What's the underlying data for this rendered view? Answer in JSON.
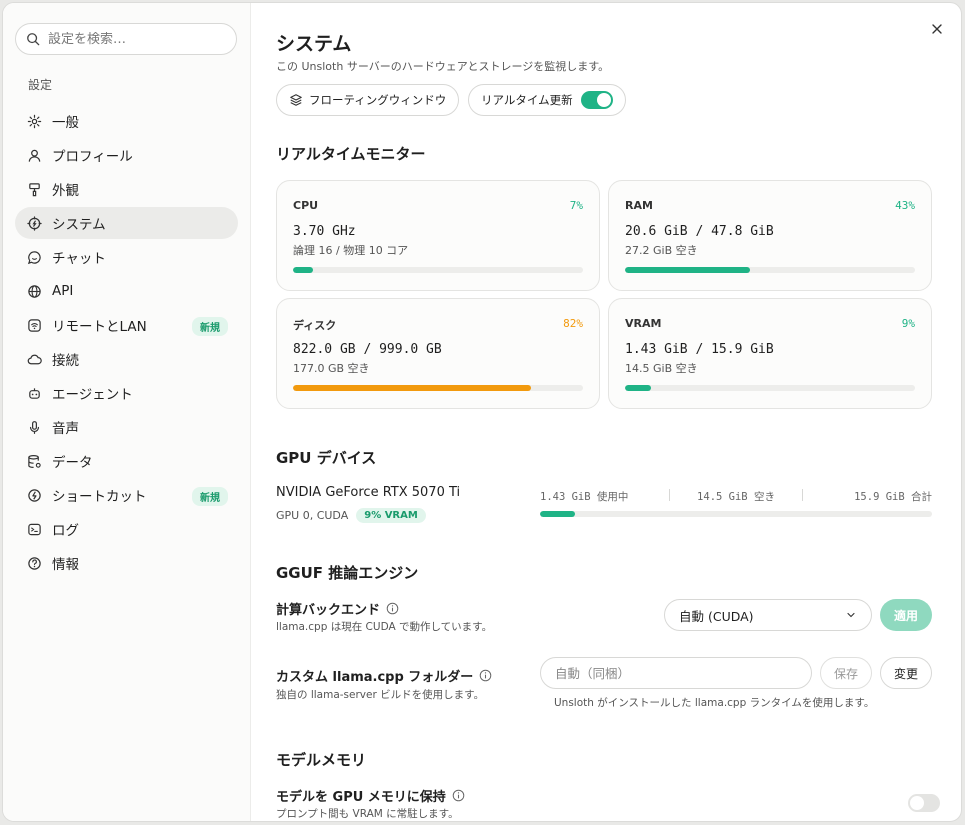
{
  "sidebar": {
    "search_placeholder": "設定を検索…",
    "heading": "設定",
    "items": [
      {
        "label": "一般",
        "icon": "gear-icon"
      },
      {
        "label": "プロフィール",
        "icon": "user-icon"
      },
      {
        "label": "外観",
        "icon": "paintbrush-icon"
      },
      {
        "label": "システム",
        "icon": "cpu-icon",
        "active": true
      },
      {
        "label": "チャット",
        "icon": "chat-icon"
      },
      {
        "label": "API",
        "icon": "globe-icon"
      },
      {
        "label": "リモートとLAN",
        "icon": "wifi-icon",
        "badge": "新規"
      },
      {
        "label": "接続",
        "icon": "cloud-icon"
      },
      {
        "label": "エージェント",
        "icon": "bot-icon"
      },
      {
        "label": "音声",
        "icon": "mic-icon"
      },
      {
        "label": "データ",
        "icon": "database-icon"
      },
      {
        "label": "ショートカット",
        "icon": "bolt-icon",
        "badge": "新規"
      },
      {
        "label": "ログ",
        "icon": "terminal-icon"
      },
      {
        "label": "情報",
        "icon": "help-icon"
      }
    ]
  },
  "header": {
    "title": "システム",
    "subtitle": "この Unsloth サーバーのハードウェアとストレージを監視します。",
    "floating_window_label": "フローティングウィンドウ",
    "realtime_label": "リアルタイム更新",
    "realtime_on": true
  },
  "monitor": {
    "title": "リアルタイムモニター",
    "cards": [
      {
        "label": "CPU",
        "pct": "7%",
        "fraction": 0.07,
        "value": "3.70 GHz",
        "sub": "論理 16 / 物理 10 コア",
        "color": "#1fb386"
      },
      {
        "label": "RAM",
        "pct": "43%",
        "fraction": 0.43,
        "value": "20.6 GiB / 47.8 GiB",
        "sub": "27.2 GiB 空き",
        "color": "#1fb386"
      },
      {
        "label": "ディスク",
        "pct": "82%",
        "fraction": 0.82,
        "value": "822.0 GB / 999.0 GB",
        "sub": "177.0 GB 空き",
        "color": "#f29a0e"
      },
      {
        "label": "VRAM",
        "pct": "9%",
        "fraction": 0.09,
        "value": "1.43 GiB / 15.9 GiB",
        "sub": "14.5 GiB 空き",
        "color": "#1fb386"
      }
    ]
  },
  "gpu": {
    "title": "GPU デバイス",
    "name": "NVIDIA GeForce RTX 5070 Ti",
    "sub": "GPU 0, CUDA",
    "badge": "9% VRAM",
    "used": "1.43 GiB 使用中",
    "free": "14.5 GiB 空き",
    "total": "15.9 GiB 合計",
    "fraction": 0.09
  },
  "engine": {
    "title": "GGUF 推論エンジン",
    "backend_label": "計算バックエンド",
    "backend_sub": "llama.cpp は現在 CUDA で動作しています。",
    "backend_value": "自動 (CUDA)",
    "apply_label": "適用",
    "folder_label": "カスタム llama.cpp フォルダー",
    "folder_sub": "独自の llama-server ビルドを使用します。",
    "folder_placeholder": "自動（同梱）",
    "save_label": "保存",
    "change_label": "変更",
    "folder_hint": "Unsloth がインストールした llama.cpp ランタイムを使用します。"
  },
  "memory": {
    "title": "モデルメモリ",
    "keep_label": "モデルを GPU メモリに保持",
    "keep_sub": "プロンプト間も VRAM に常駐します。",
    "keep_on": false
  }
}
